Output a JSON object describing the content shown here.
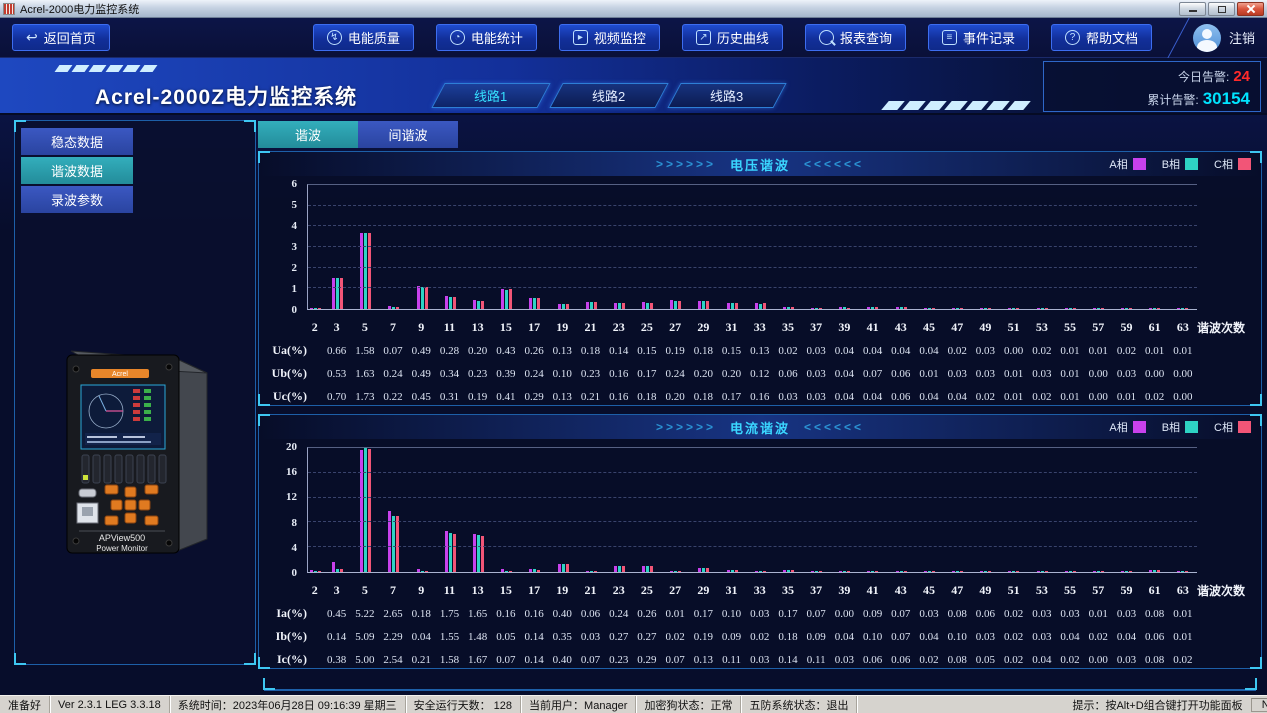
{
  "window": {
    "title": "Acrel-2000电力监控系统"
  },
  "nav": {
    "back_label": "返回首页",
    "back_icon": "↩",
    "items": [
      "电能质量",
      "电能统计",
      "视频监控",
      "历史曲线",
      "报表查询",
      "事件记录",
      "帮助文档"
    ],
    "icon_glyphs": {
      "quality": "↯",
      "stats": "◔",
      "video": "▸",
      "curve": "↗",
      "report": "",
      "event": "≡",
      "help": "?"
    },
    "logout_label": "注销"
  },
  "header": {
    "title": "Acrel-2000Z电力监控系统",
    "tabs": [
      {
        "label": "线路1",
        "active": true
      },
      {
        "label": "线路2",
        "active": false
      },
      {
        "label": "线路3",
        "active": false
      }
    ],
    "alarms": {
      "today_label": "今日告警:",
      "today_value": "24",
      "total_label": "累计告警:",
      "total_value": "30154"
    }
  },
  "sidebar": {
    "items": [
      {
        "label": "稳态数据",
        "active": false
      },
      {
        "label": "谐波数据",
        "active": true
      },
      {
        "label": "录波参数",
        "active": false
      }
    ],
    "device": {
      "brand": "Acrel",
      "line1": "APView500",
      "line2": "Power Monitor"
    }
  },
  "main": {
    "tabs": [
      {
        "label": "谐波",
        "active": true
      },
      {
        "label": "间谐波",
        "active": false
      }
    ]
  },
  "colors": {
    "phase_a": "#c841ec",
    "phase_b": "#2ed3c4",
    "phase_c": "#f25577",
    "alarm_red": "#ff2a2a",
    "alarm_cyan": "#00e4ff",
    "panel_border": "#1d5fa8",
    "accent_cyan": "#3ec7f2"
  },
  "chart_data": [
    {
      "type": "bar",
      "title": "电压谐波",
      "decor_left": ">>>>>>",
      "decor_right": "<<<<<<",
      "legend": [
        "A相",
        "B相",
        "C相"
      ],
      "xlabel_right": "谐波次数",
      "categories": [
        "2",
        "3",
        "5",
        "7",
        "9",
        "11",
        "13",
        "15",
        "17",
        "19",
        "21",
        "23",
        "25",
        "27",
        "29",
        "31",
        "33",
        "35",
        "37",
        "39",
        "41",
        "43",
        "45",
        "47",
        "49",
        "51",
        "53",
        "55",
        "57",
        "59",
        "61",
        "63"
      ],
      "ylim": [
        0,
        6
      ],
      "yticks": [
        0,
        1,
        2,
        3,
        4,
        5,
        6
      ],
      "grid": "dashed",
      "legend_position": "top-right",
      "series": [
        {
          "name": "A相",
          "values": [
            0.06,
            1.52,
            3.7,
            0.14,
            1.1,
            0.62,
            0.42,
            0.95,
            0.55,
            0.25,
            0.36,
            0.3,
            0.32,
            0.42,
            0.4,
            0.3,
            0.28,
            0.08,
            0.06,
            0.08,
            0.08,
            0.08,
            0.06,
            0.05,
            0.06,
            0.02,
            0.04,
            0.02,
            0.02,
            0.04,
            0.02,
            0.02
          ]
        },
        {
          "name": "B相",
          "values": [
            0.05,
            1.5,
            3.66,
            0.12,
            1.08,
            0.6,
            0.4,
            0.93,
            0.52,
            0.24,
            0.34,
            0.3,
            0.3,
            0.4,
            0.38,
            0.3,
            0.26,
            0.1,
            0.05,
            0.08,
            0.09,
            0.08,
            0.04,
            0.06,
            0.05,
            0.02,
            0.04,
            0.02,
            0.01,
            0.04,
            0.01,
            0.01
          ]
        },
        {
          "name": "C相",
          "values": [
            0.06,
            1.48,
            3.68,
            0.12,
            1.06,
            0.6,
            0.41,
            0.95,
            0.53,
            0.25,
            0.35,
            0.29,
            0.31,
            0.4,
            0.38,
            0.29,
            0.27,
            0.08,
            0.05,
            0.07,
            0.08,
            0.09,
            0.06,
            0.06,
            0.04,
            0.02,
            0.04,
            0.02,
            0.01,
            0.03,
            0.03,
            0.01
          ]
        }
      ],
      "table": {
        "rows": [
          {
            "label": "Ua(%)",
            "values": [
              "0.66",
              "1.58",
              "0.07",
              "0.49",
              "0.28",
              "0.20",
              "0.43",
              "0.26",
              "0.13",
              "0.18",
              "0.14",
              "0.15",
              "0.19",
              "0.18",
              "0.15",
              "0.13",
              "0.02",
              "0.03",
              "0.04",
              "0.04",
              "0.04",
              "0.04",
              "0.02",
              "0.03",
              "0.00",
              "0.02",
              "0.01",
              "0.01",
              "0.02",
              "0.01",
              "0.01"
            ]
          },
          {
            "label": "Ub(%)",
            "values": [
              "0.53",
              "1.63",
              "0.24",
              "0.49",
              "0.34",
              "0.23",
              "0.39",
              "0.24",
              "0.10",
              "0.23",
              "0.16",
              "0.17",
              "0.24",
              "0.20",
              "0.20",
              "0.12",
              "0.06",
              "0.03",
              "0.04",
              "0.07",
              "0.06",
              "0.01",
              "0.03",
              "0.03",
              "0.01",
              "0.03",
              "0.01",
              "0.00",
              "0.03",
              "0.00",
              "0.00"
            ]
          },
          {
            "label": "Uc(%)",
            "values": [
              "0.70",
              "1.73",
              "0.22",
              "0.45",
              "0.31",
              "0.19",
              "0.41",
              "0.29",
              "0.13",
              "0.21",
              "0.16",
              "0.18",
              "0.20",
              "0.18",
              "0.17",
              "0.16",
              "0.03",
              "0.03",
              "0.04",
              "0.04",
              "0.06",
              "0.04",
              "0.04",
              "0.02",
              "0.01",
              "0.02",
              "0.01",
              "0.00",
              "0.01",
              "0.02",
              "0.00"
            ]
          }
        ]
      }
    },
    {
      "type": "bar",
      "title": "电流谐波",
      "decor_left": ">>>>>>",
      "decor_right": "<<<<<<",
      "legend": [
        "A相",
        "B相",
        "C相"
      ],
      "xlabel_right": "谐波次数",
      "categories": [
        "2",
        "3",
        "5",
        "7",
        "9",
        "11",
        "13",
        "15",
        "17",
        "19",
        "21",
        "23",
        "25",
        "27",
        "29",
        "31",
        "33",
        "35",
        "37",
        "39",
        "41",
        "43",
        "45",
        "47",
        "49",
        "51",
        "53",
        "55",
        "57",
        "59",
        "61",
        "63"
      ],
      "ylim": [
        0,
        20
      ],
      "yticks": [
        0,
        4,
        8,
        12,
        16,
        20
      ],
      "grid": "dashed",
      "legend_position": "top-right",
      "series": [
        {
          "name": "A相",
          "values": [
            0.25,
            1.6,
            19.6,
            9.9,
            0.55,
            6.6,
            6.2,
            0.55,
            0.5,
            1.35,
            0.12,
            0.95,
            1.05,
            0.1,
            0.62,
            0.38,
            0.1,
            0.35,
            0.12,
            0.05,
            0.22,
            0.15,
            0.06,
            0.2,
            0.12,
            0.04,
            0.08,
            0.06,
            0.02,
            0.08,
            0.28,
            0.04
          ]
        },
        {
          "name": "B相",
          "values": [
            0.22,
            0.55,
            20.0,
            9.1,
            0.12,
            6.25,
            5.9,
            0.1,
            0.42,
            1.3,
            0.1,
            0.9,
            1.0,
            0.08,
            0.6,
            0.35,
            0.08,
            0.35,
            0.15,
            0.06,
            0.2,
            0.14,
            0.06,
            0.22,
            0.1,
            0.04,
            0.08,
            0.07,
            0.03,
            0.08,
            0.25,
            0.03
          ]
        },
        {
          "name": "C相",
          "values": [
            0.2,
            0.5,
            19.9,
            9.0,
            0.1,
            6.1,
            5.8,
            0.12,
            0.4,
            1.3,
            0.1,
            0.92,
            1.02,
            0.1,
            0.58,
            0.36,
            0.08,
            0.32,
            0.14,
            0.05,
            0.18,
            0.12,
            0.05,
            0.2,
            0.12,
            0.04,
            0.09,
            0.05,
            0.02,
            0.08,
            0.28,
            0.05
          ]
        }
      ],
      "table": {
        "rows": [
          {
            "label": "Ia(%)",
            "values": [
              "0.45",
              "5.22",
              "2.65",
              "0.18",
              "1.75",
              "1.65",
              "0.16",
              "0.16",
              "0.40",
              "0.06",
              "0.24",
              "0.26",
              "0.01",
              "0.17",
              "0.10",
              "0.03",
              "0.17",
              "0.07",
              "0.00",
              "0.09",
              "0.07",
              "0.03",
              "0.08",
              "0.06",
              "0.02",
              "0.03",
              "0.03",
              "0.01",
              "0.03",
              "0.08",
              "0.01"
            ]
          },
          {
            "label": "Ib(%)",
            "values": [
              "0.14",
              "5.09",
              "2.29",
              "0.04",
              "1.55",
              "1.48",
              "0.05",
              "0.14",
              "0.35",
              "0.03",
              "0.27",
              "0.27",
              "0.02",
              "0.19",
              "0.09",
              "0.02",
              "0.18",
              "0.09",
              "0.04",
              "0.10",
              "0.07",
              "0.04",
              "0.10",
              "0.03",
              "0.02",
              "0.03",
              "0.04",
              "0.02",
              "0.04",
              "0.06",
              "0.01"
            ]
          },
          {
            "label": "Ic(%)",
            "values": [
              "0.38",
              "5.00",
              "2.54",
              "0.21",
              "1.58",
              "1.67",
              "0.07",
              "0.14",
              "0.40",
              "0.07",
              "0.23",
              "0.29",
              "0.07",
              "0.13",
              "0.11",
              "0.03",
              "0.14",
              "0.11",
              "0.03",
              "0.06",
              "0.06",
              "0.02",
              "0.08",
              "0.05",
              "0.02",
              "0.04",
              "0.02",
              "0.00",
              "0.03",
              "0.08",
              "0.02"
            ]
          }
        ]
      }
    }
  ],
  "statusbar": {
    "segments": [
      "准备好",
      "Ver 2.3.1 LEG 3.3.18",
      "系统时间：2023年06月28日  09:16:39  星期三",
      "安全运行天数：  128",
      "当前用户：Manager",
      "加密狗状态：正常",
      "五防系统状态：退出"
    ],
    "hint": "提示：按Alt+D组合键打开功能面板",
    "num": "NUM"
  }
}
